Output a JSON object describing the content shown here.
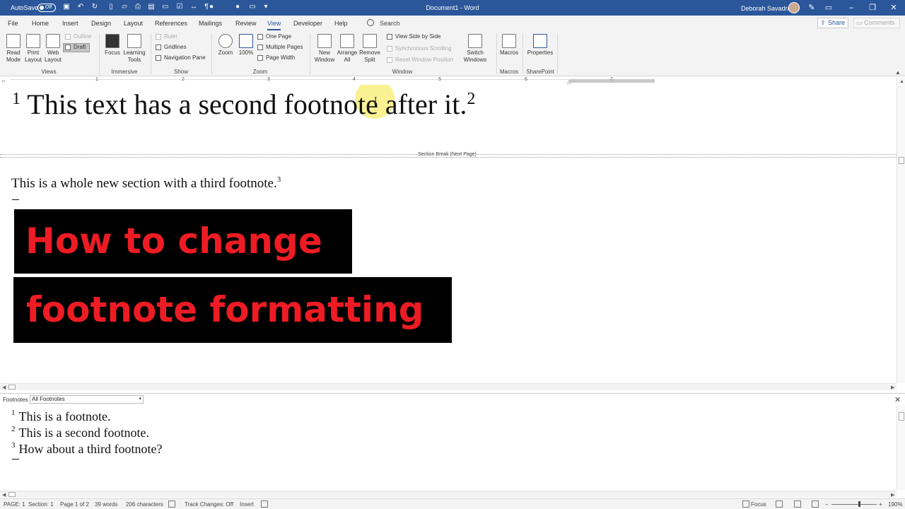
{
  "titlebar": {
    "autosave_label": "AutoSave",
    "autosave_state": "Off",
    "document_title": "Document1 - Word",
    "user_name": "Deborah Savadra"
  },
  "tabs": [
    {
      "label": "File"
    },
    {
      "label": "Home"
    },
    {
      "label": "Insert"
    },
    {
      "label": "Design"
    },
    {
      "label": "Layout"
    },
    {
      "label": "References"
    },
    {
      "label": "Mailings"
    },
    {
      "label": "Review"
    },
    {
      "label": "View"
    },
    {
      "label": "Developer"
    },
    {
      "label": "Help"
    }
  ],
  "active_tab": "View",
  "search_label": "Search",
  "share_label": "Share",
  "comments_label": "Comments",
  "ribbon": {
    "views": {
      "read_mode": "Read Mode",
      "print_layout": "Print Layout",
      "web_layout": "Web Layout",
      "outline": "Outline",
      "draft": "Draft",
      "group": "Views"
    },
    "immersive": {
      "focus": "Focus",
      "learning_tools": "Learning Tools",
      "group": "Immersive"
    },
    "show": {
      "ruler": "Ruler",
      "gridlines": "Gridlines",
      "navigation_pane": "Navigation Pane",
      "group": "Show"
    },
    "zoom": {
      "zoom": "Zoom",
      "hundred": "100%",
      "one_page": "One Page",
      "multiple_pages": "Multiple Pages",
      "page_width": "Page Width",
      "group": "Zoom"
    },
    "window": {
      "new_window": "New Window",
      "arrange_all": "Arrange All",
      "remove_split": "Remove Split",
      "side_by_side": "View Side by Side",
      "sync_scrolling": "Synchronous Scrolling",
      "reset_position": "Reset Window Position",
      "switch_windows": "Switch Windows",
      "group": "Window"
    },
    "macros": {
      "macros": "Macros",
      "group": "Macros"
    },
    "sharepoint": {
      "properties": "Properties",
      "group": "SharePoint"
    }
  },
  "ruler_numbers": [
    "1",
    "2",
    "3",
    "4",
    "5",
    "6",
    "7"
  ],
  "document": {
    "line1_fnref_before": "1",
    "line1_text": "This text has a second footnote after it.",
    "line1_fnref_after": "2",
    "section_break_label": "Section Break (Next Page)",
    "para2_text": "This is a whole new section with a third footnote.",
    "para2_fnref": "3",
    "banner1": "How to change",
    "banner2": "footnote formatting"
  },
  "footnotes_pane": {
    "label": "Footnotes",
    "filter_value": "All Footnotes",
    "items": [
      {
        "ref": "1",
        "text": "This is a footnote."
      },
      {
        "ref": "2",
        "text": "This is a second footnote."
      },
      {
        "ref": "3",
        "text": "How about a third footnote?"
      }
    ]
  },
  "statusbar": {
    "page": "PAGE: 1",
    "section": "Section: 1",
    "page_of": "Page 1 of 2",
    "words": "39 words",
    "characters": "206 characters",
    "track_changes": "Track Changes: Off",
    "insert_mode": "Insert",
    "focus": "Focus",
    "zoom_level": "190%"
  },
  "colors": {
    "word_blue": "#2b579a",
    "banner_red": "#ed1c24",
    "banner_bg": "#000000",
    "highlight": "#f8ee6e"
  }
}
